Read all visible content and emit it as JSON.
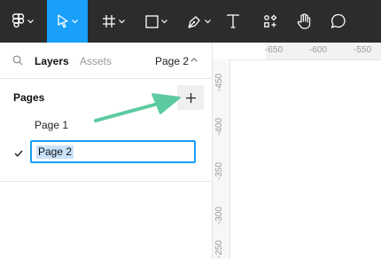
{
  "toolbar": {
    "tools": [
      {
        "name": "figma-menu-icon"
      },
      {
        "name": "move-tool-icon"
      },
      {
        "name": "frame-tool-icon"
      },
      {
        "name": "shape-tool-icon"
      },
      {
        "name": "pen-tool-icon"
      },
      {
        "name": "text-tool-icon"
      },
      {
        "name": "components-icon"
      },
      {
        "name": "hand-tool-icon"
      },
      {
        "name": "comment-tool-icon"
      }
    ],
    "active_tool": "move-tool-icon"
  },
  "panel": {
    "tab_layers": "Layers",
    "tab_assets": "Assets",
    "current_page": "Page 2",
    "pages_header": "Pages",
    "add_page_symbol": "+",
    "pages": [
      {
        "label": "Page 1",
        "selected": false
      },
      {
        "label": "Page 2",
        "selected": true
      }
    ],
    "rename_value": "Page 2"
  },
  "ruler": {
    "horizontal": [
      "-650",
      "-600",
      "-550"
    ],
    "vertical": [
      "-450",
      "-400",
      "-350",
      "-300",
      "-250"
    ]
  },
  "colors": {
    "toolbar_bg": "#2c2c2c",
    "accent": "#18a0fb",
    "annotation_arrow": "#5ccba0"
  }
}
